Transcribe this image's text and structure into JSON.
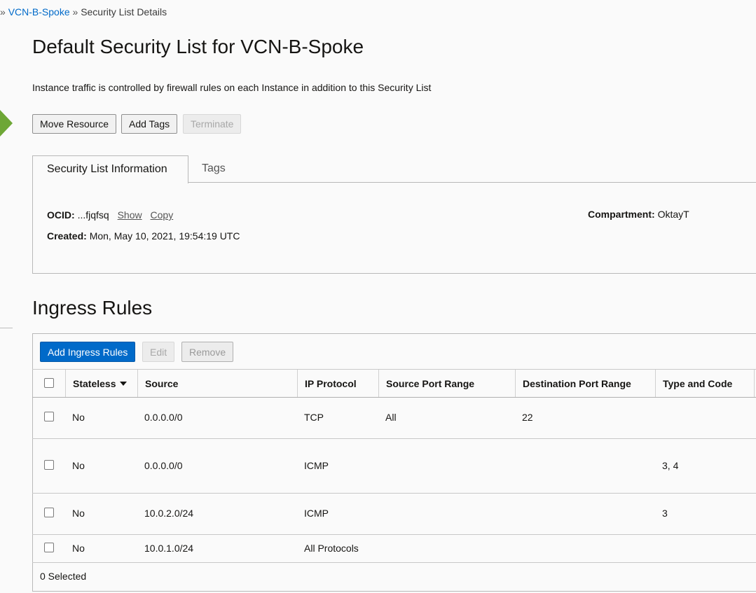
{
  "breadcrumb": {
    "prefix": "»",
    "vcn_link": "VCN-B-Spoke",
    "separator": "»",
    "current": "Security List Details"
  },
  "page": {
    "title": "Default Security List for VCN-B-Spoke",
    "description": "Instance traffic is controlled by firewall rules on each Instance in addition to this Security List"
  },
  "actions": {
    "move_resource": "Move Resource",
    "add_tags": "Add Tags",
    "terminate": "Terminate"
  },
  "tabs": {
    "info": "Security List Information",
    "tags": "Tags"
  },
  "info": {
    "ocid_label": "OCID:",
    "ocid_value": "...fjqfsq",
    "show": "Show",
    "copy": "Copy",
    "created_label": "Created:",
    "created_value": "Mon, May 10, 2021, 19:54:19 UTC",
    "compartment_label": "Compartment:",
    "compartment_value": "OktayT"
  },
  "ingress": {
    "title": "Ingress Rules",
    "add_button": "Add Ingress Rules",
    "edit_button": "Edit",
    "remove_button": "Remove",
    "columns": {
      "stateless": "Stateless",
      "source": "Source",
      "ip_protocol": "IP Protocol",
      "source_port_range": "Source Port Range",
      "destination_port_range": "Destination Port Range",
      "type_and_code": "Type and Code"
    },
    "rows": [
      {
        "stateless": "No",
        "source": "0.0.0.0/0",
        "protocol": "TCP",
        "src_port": "All",
        "dst_port": "22",
        "type_code": ""
      },
      {
        "stateless": "No",
        "source": "0.0.0.0/0",
        "protocol": "ICMP",
        "src_port": "",
        "dst_port": "",
        "type_code": "3, 4"
      },
      {
        "stateless": "No",
        "source": "10.0.2.0/24",
        "protocol": "ICMP",
        "src_port": "",
        "dst_port": "",
        "type_code": "3"
      },
      {
        "stateless": "No",
        "source": "10.0.1.0/24",
        "protocol": "All Protocols",
        "src_port": "",
        "dst_port": "",
        "type_code": ""
      }
    ],
    "selected_count": "0 Selected"
  },
  "colors": {
    "link": "#006ac9",
    "primary_button": "#006ac9",
    "accent_arrow": "#6ea736"
  }
}
